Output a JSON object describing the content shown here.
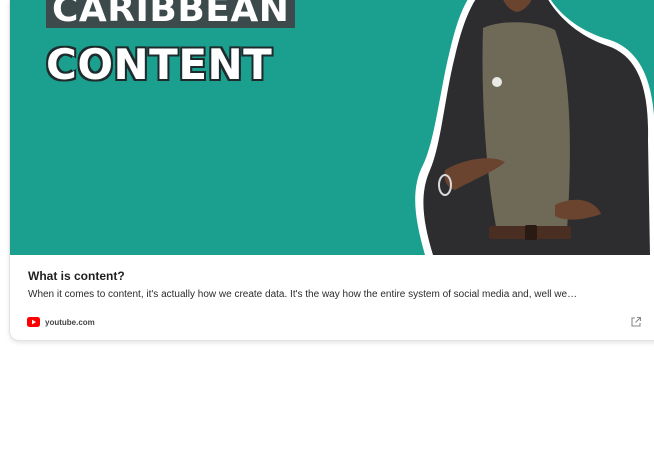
{
  "thumbnail": {
    "headline_line1": "CARIBBEAN",
    "headline_line2": "CONTENT",
    "background_color": "#1b9f8e"
  },
  "link_card": {
    "title": "What is content?",
    "description": "When it comes to content, it's actually how we create data. It's the way how the entire system of social media and, well we…",
    "source_domain": "youtube.com",
    "source_icon": "youtube-icon",
    "action_icon": "external-link-icon"
  }
}
